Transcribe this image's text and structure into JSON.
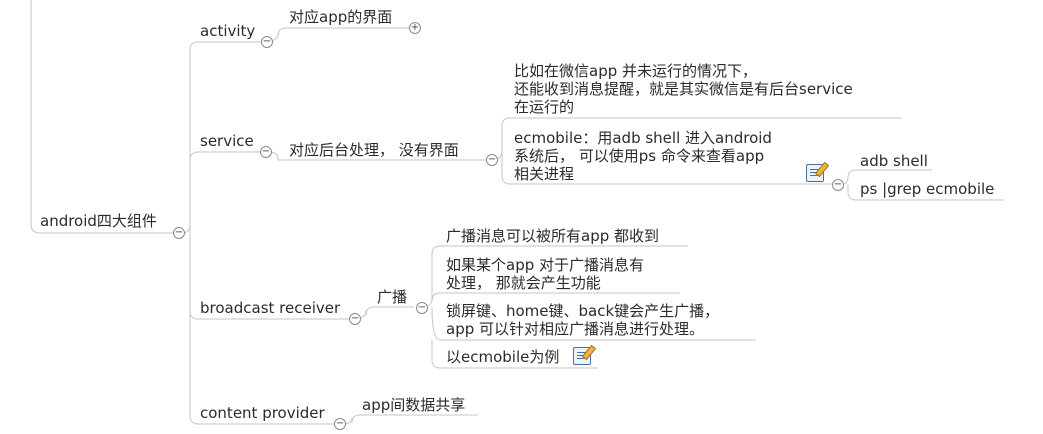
{
  "root": {
    "label": "android四大组件"
  },
  "activity": {
    "label": "activity",
    "child": "对应app的界面"
  },
  "service": {
    "label": "service",
    "child": "对应后台处理， 没有界面",
    "notes": [
      "比如在微信app 并未运行的情况下，",
      "还能收到消息提醒，就是其实微信是有后台service",
      "在运行的"
    ],
    "ecmobile": [
      "ecmobile：用adb shell 进入android",
      "系统后， 可以使用ps 命令来查看app",
      "相关进程"
    ],
    "commands": [
      "adb shell",
      "ps |grep ecmobile"
    ]
  },
  "broadcast": {
    "label": "broadcast receiver",
    "child": "广播",
    "items": [
      [
        "广播消息可以被所有app 都收到"
      ],
      [
        "如果某个app 对于广播消息有",
        "处理， 那就会产生功能"
      ],
      [
        "锁屏键、home键、back键会产生广播，",
        "app 可以针对相应广播消息进行处理。"
      ],
      [
        "以ecmobile为例"
      ]
    ]
  },
  "provider": {
    "label": "content provider",
    "child": "app间数据共享"
  },
  "toggles": {
    "collapse": "−",
    "expand": "+"
  },
  "colors": {
    "line": "#c6c6c6",
    "text": "#2b2b2b"
  }
}
